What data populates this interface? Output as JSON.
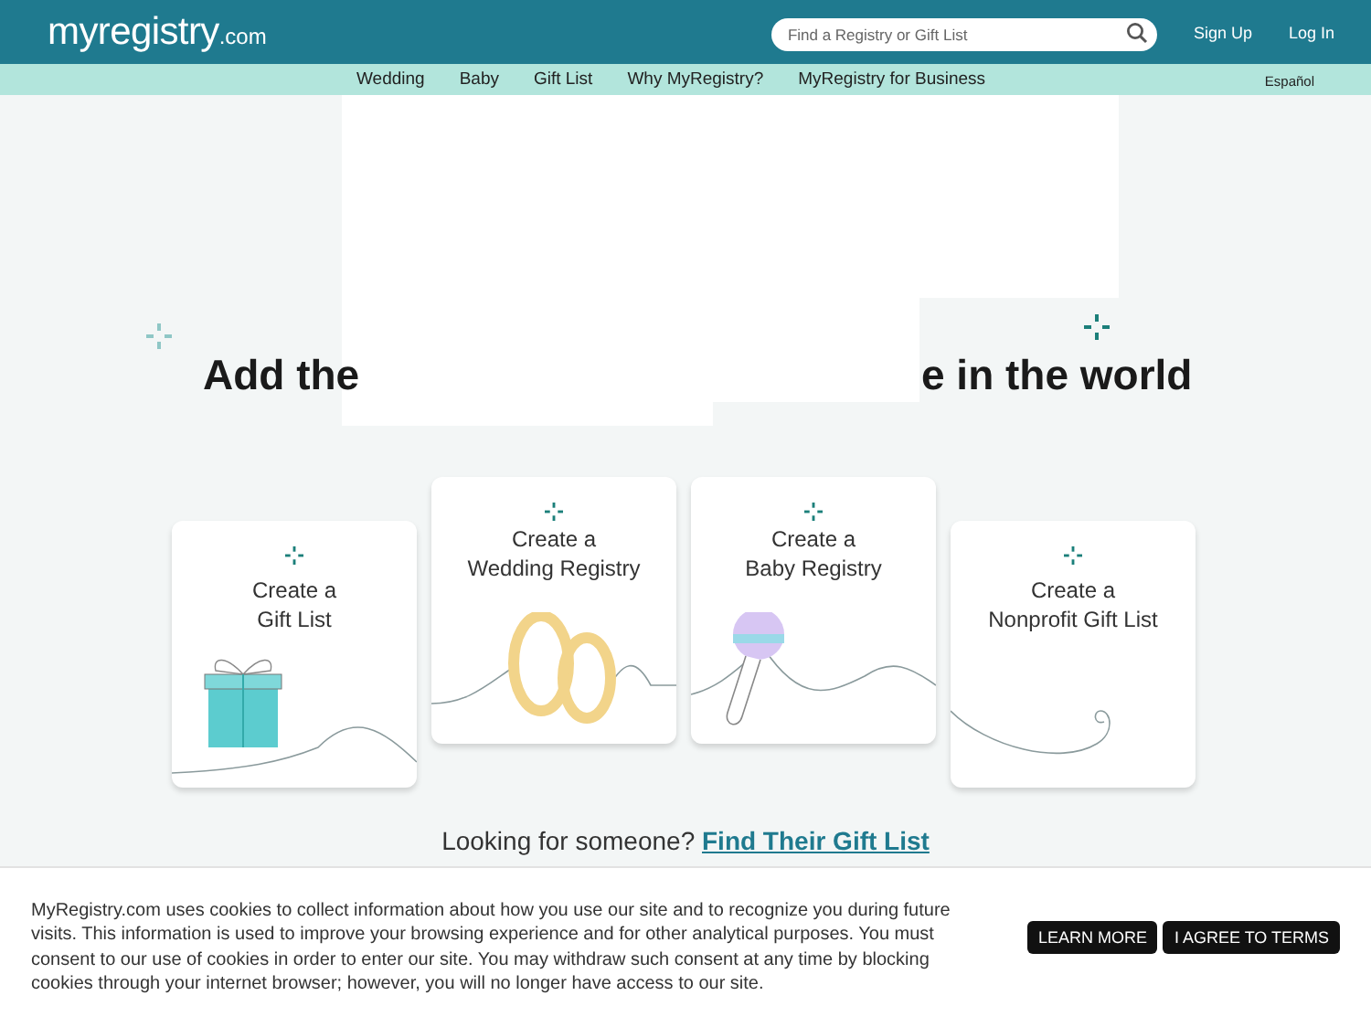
{
  "header": {
    "logo_main": "myregistry",
    "logo_suffix": ".com",
    "search": {
      "placeholder": "Find a Registry or Gift List"
    },
    "links": [
      "Sign Up",
      "Log In"
    ]
  },
  "nav": {
    "items": [
      "Wedding",
      "Baby",
      "Gift List",
      "Why MyRegistry?",
      "MyRegistry for Business"
    ],
    "language": "Español"
  },
  "heading": [
    "Add the",
    "e in the world"
  ],
  "cards": [
    {
      "kind": "gift",
      "raised": false,
      "lines": [
        "Create a",
        "Gift List"
      ]
    },
    {
      "kind": "wedding",
      "raised": true,
      "lines": [
        "Create a",
        "Wedding Registry"
      ]
    },
    {
      "kind": "baby",
      "raised": true,
      "lines": [
        "Create a",
        "Baby Registry"
      ]
    },
    {
      "kind": "nonprofit",
      "raised": false,
      "lines": [
        "Create a",
        "Nonprofit Gift List"
      ]
    }
  ],
  "lookup": {
    "text": "Looking for someone?",
    "link": "Find Their Gift List"
  },
  "cookie": {
    "text": "MyRegistry.com uses cookies to collect information about how you use our site and to recognize you during future visits. This information is used to improve your browsing experience and for other analytical purposes. You must consent to our use of cookies in order to enter our site. You may withdraw such consent at any time by blocking cookies through your internet browser; however, you will no longer have access to our site.",
    "buttons": [
      "LEARN MORE",
      "I AGREE TO TERMS"
    ]
  }
}
